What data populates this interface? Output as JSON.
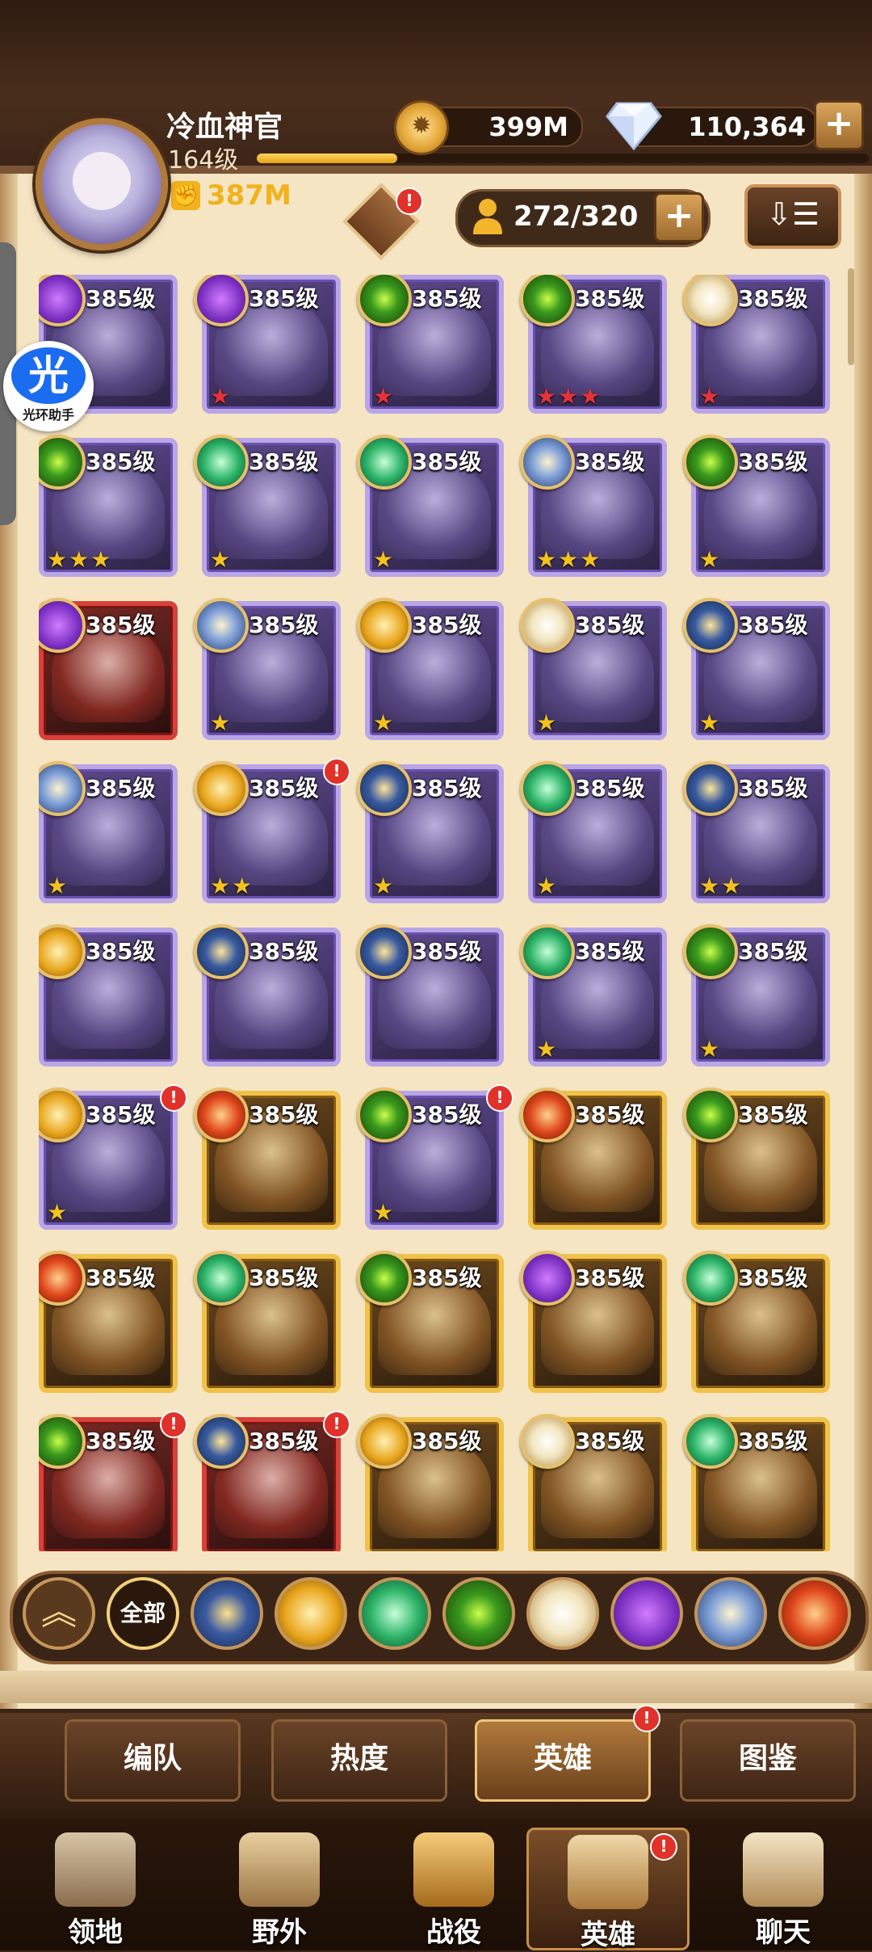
{
  "header": {
    "player_name": "冷血神官",
    "level": "164级",
    "xp_progress": 0.23,
    "power": "387M",
    "gold": "399M",
    "gems": "110,364",
    "roster": "272/320",
    "add_gold_label": "+",
    "add_roster_label": "+"
  },
  "assistant": {
    "label": "光环助手",
    "glyph": "光"
  },
  "heroes": [
    {
      "level": "385级",
      "frame": "purple",
      "faction": "purple",
      "stars": "★",
      "star_color": "red",
      "badge": false
    },
    {
      "level": "385级",
      "frame": "purple",
      "faction": "purple",
      "stars": "★",
      "star_color": "red",
      "badge": false
    },
    {
      "level": "385级",
      "frame": "purple",
      "faction": "green-eye",
      "stars": "★",
      "star_color": "red",
      "badge": false
    },
    {
      "level": "385级",
      "frame": "purple",
      "faction": "green-eye",
      "stars": "★★★",
      "star_color": "red",
      "badge": false
    },
    {
      "level": "385级",
      "frame": "purple",
      "faction": "white",
      "stars": "★",
      "star_color": "red",
      "badge": false
    },
    {
      "level": "385级",
      "frame": "purple",
      "faction": "green-eye",
      "stars": "★★★",
      "star_color": "gold",
      "badge": false
    },
    {
      "level": "385级",
      "frame": "purple",
      "faction": "leaf",
      "stars": "★",
      "star_color": "gold",
      "badge": false
    },
    {
      "level": "385级",
      "frame": "purple",
      "faction": "leaf",
      "stars": "★",
      "star_color": "gold",
      "badge": false
    },
    {
      "level": "385级",
      "frame": "purple",
      "faction": "orb",
      "stars": "★★★",
      "star_color": "gold",
      "badge": false
    },
    {
      "level": "385级",
      "frame": "purple",
      "faction": "green-eye",
      "stars": "★",
      "star_color": "gold",
      "badge": false
    },
    {
      "level": "385级",
      "frame": "red",
      "faction": "purple",
      "stars": "",
      "star_color": "gold",
      "badge": false
    },
    {
      "level": "385级",
      "frame": "purple",
      "faction": "orb",
      "stars": "★",
      "star_color": "gold",
      "badge": false
    },
    {
      "level": "385级",
      "frame": "purple",
      "faction": "gold",
      "stars": "★",
      "star_color": "gold",
      "badge": false
    },
    {
      "level": "385级",
      "frame": "purple",
      "faction": "white",
      "stars": "★",
      "star_color": "gold",
      "badge": false
    },
    {
      "level": "385级",
      "frame": "purple",
      "faction": "blue",
      "stars": "★",
      "star_color": "gold",
      "badge": false
    },
    {
      "level": "385级",
      "frame": "purple",
      "faction": "orb",
      "stars": "★",
      "star_color": "gold",
      "badge": false
    },
    {
      "level": "385级",
      "frame": "purple",
      "faction": "gold",
      "stars": "★★",
      "star_color": "gold",
      "badge": true
    },
    {
      "level": "385级",
      "frame": "purple",
      "faction": "blue",
      "stars": "★",
      "star_color": "gold",
      "badge": false
    },
    {
      "level": "385级",
      "frame": "purple",
      "faction": "leaf",
      "stars": "★",
      "star_color": "gold",
      "badge": false
    },
    {
      "level": "385级",
      "frame": "purple",
      "faction": "blue",
      "stars": "★★",
      "star_color": "gold",
      "badge": false
    },
    {
      "level": "385级",
      "frame": "purple",
      "faction": "gold",
      "stars": "",
      "star_color": "gold",
      "badge": false
    },
    {
      "level": "385级",
      "frame": "purple",
      "faction": "blue",
      "stars": "",
      "star_color": "gold",
      "badge": false
    },
    {
      "level": "385级",
      "frame": "purple",
      "faction": "blue",
      "stars": "",
      "star_color": "gold",
      "badge": false
    },
    {
      "level": "385级",
      "frame": "purple",
      "faction": "leaf",
      "stars": "★",
      "star_color": "gold",
      "badge": false
    },
    {
      "level": "385级",
      "frame": "purple",
      "faction": "green-eye",
      "stars": "★",
      "star_color": "gold",
      "badge": false
    },
    {
      "level": "385级",
      "frame": "purple",
      "faction": "gold",
      "stars": "★",
      "star_color": "gold",
      "badge": true
    },
    {
      "level": "385级",
      "frame": "gold",
      "faction": "fire",
      "stars": "",
      "star_color": "gold",
      "badge": false
    },
    {
      "level": "385级",
      "frame": "purple",
      "faction": "green-eye",
      "stars": "★",
      "star_color": "gold",
      "badge": true
    },
    {
      "level": "385级",
      "frame": "gold",
      "faction": "fire",
      "stars": "",
      "star_color": "gold",
      "badge": false
    },
    {
      "level": "385级",
      "frame": "gold",
      "faction": "green-eye",
      "stars": "",
      "star_color": "gold",
      "badge": false
    },
    {
      "level": "385级",
      "frame": "gold",
      "faction": "fire",
      "stars": "",
      "star_color": "gold",
      "badge": false
    },
    {
      "level": "385级",
      "frame": "gold",
      "faction": "leaf",
      "stars": "",
      "star_color": "gold",
      "badge": false
    },
    {
      "level": "385级",
      "frame": "gold",
      "faction": "green-eye",
      "stars": "",
      "star_color": "gold",
      "badge": false
    },
    {
      "level": "385级",
      "frame": "gold",
      "faction": "purple",
      "stars": "",
      "star_color": "gold",
      "badge": false
    },
    {
      "level": "385级",
      "frame": "gold",
      "faction": "leaf",
      "stars": "",
      "star_color": "gold",
      "badge": false
    },
    {
      "level": "385级",
      "frame": "red",
      "faction": "green-eye",
      "stars": "",
      "star_color": "gold",
      "badge": true
    },
    {
      "level": "385级",
      "frame": "red",
      "faction": "blue",
      "stars": "",
      "star_color": "gold",
      "badge": true
    },
    {
      "level": "385级",
      "frame": "gold",
      "faction": "gold",
      "stars": "",
      "star_color": "gold",
      "badge": false
    },
    {
      "level": "385级",
      "frame": "gold",
      "faction": "white",
      "stars": "",
      "star_color": "gold",
      "badge": false
    },
    {
      "level": "385级",
      "frame": "gold",
      "faction": "leaf",
      "stars": "",
      "star_color": "gold",
      "badge": false
    }
  ],
  "filters": {
    "all_label": "全部",
    "items": [
      "blue-star-icon",
      "gold-sun-icon",
      "leaf-icon",
      "green-eye-icon",
      "white-star-icon",
      "purple-crystal-icon",
      "orb-icon",
      "fire-icon"
    ]
  },
  "subtabs": [
    {
      "label": "编队",
      "active": false,
      "badge": false
    },
    {
      "label": "热度",
      "active": false,
      "badge": false
    },
    {
      "label": "英雄",
      "active": true,
      "badge": true
    },
    {
      "label": "图鉴",
      "active": false,
      "badge": false
    }
  ],
  "nav": [
    {
      "label": "领地",
      "icon": "castle-icon",
      "active": false,
      "badge": false
    },
    {
      "label": "野外",
      "icon": "map-scroll-icon",
      "active": false,
      "badge": false
    },
    {
      "label": "战役",
      "icon": "sword-crest-icon",
      "active": false,
      "badge": false
    },
    {
      "label": "英雄",
      "icon": "hero-helmet-icon",
      "active": true,
      "badge": true
    },
    {
      "label": "聊天",
      "icon": "chat-bubble-icon",
      "active": false,
      "badge": false
    }
  ],
  "badge_mark": "!"
}
